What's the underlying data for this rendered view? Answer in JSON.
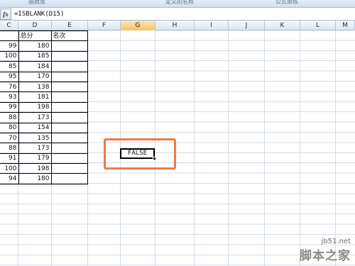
{
  "ribbon": {
    "groups": [
      "函数库",
      "定义的名称",
      "公式审核"
    ]
  },
  "formula_bar": {
    "fx_label": "fx",
    "formula": "=ISBLANK(D15)"
  },
  "columns": [
    "C",
    "D",
    "E",
    "F",
    "G",
    "H",
    "I",
    "J",
    "K",
    "L",
    "M"
  ],
  "active_column": "G",
  "table": {
    "headers": [
      "",
      "总分",
      "名次"
    ],
    "rows": [
      [
        "99",
        "180",
        ""
      ],
      [
        "100",
        "185",
        ""
      ],
      [
        "85",
        "184",
        ""
      ],
      [
        "95",
        "170",
        ""
      ],
      [
        "76",
        "138",
        ""
      ],
      [
        "93",
        "181",
        ""
      ],
      [
        "99",
        "198",
        ""
      ],
      [
        "88",
        "173",
        ""
      ],
      [
        "80",
        "154",
        ""
      ],
      [
        "70",
        "135",
        ""
      ],
      [
        "88",
        "173",
        ""
      ],
      [
        "91",
        "179",
        ""
      ],
      [
        "100",
        "198",
        ""
      ],
      [
        "94",
        "180",
        ""
      ]
    ]
  },
  "active_cell": {
    "value": "FALSE"
  },
  "highlight_color": "#ee7a4a",
  "watermark": {
    "url": "jb51.net",
    "brand": "脚本之家"
  }
}
